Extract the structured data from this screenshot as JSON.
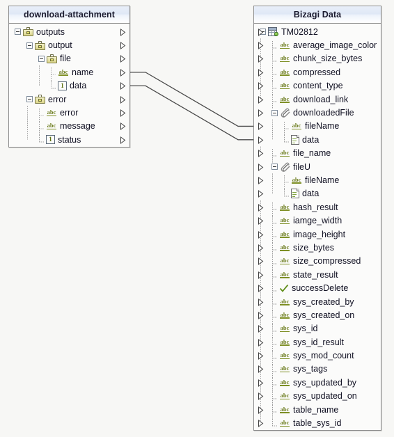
{
  "left_panel": {
    "title": "download-attachment",
    "nodes": [
      {
        "label": "outputs",
        "icon": "briefcase-icon",
        "depth": 0,
        "expander": true,
        "port": true
      },
      {
        "label": "output",
        "icon": "briefcase-icon",
        "depth": 1,
        "expander": true,
        "port": true
      },
      {
        "label": "file",
        "icon": "briefcase-icon",
        "depth": 2,
        "expander": true,
        "port": true
      },
      {
        "label": "name",
        "icon": "abc-string-icon",
        "depth": 3,
        "expander": false,
        "port": true
      },
      {
        "label": "data",
        "icon": "number-icon",
        "depth": 3,
        "expander": false,
        "port": true,
        "last": true
      },
      {
        "label": "error",
        "icon": "briefcase-icon",
        "depth": 1,
        "expander": true,
        "port": true
      },
      {
        "label": "error",
        "icon": "abc-string-icon",
        "depth": 2,
        "expander": false,
        "port": true
      },
      {
        "label": "message",
        "icon": "abc-string-icon",
        "depth": 2,
        "expander": false,
        "port": true
      },
      {
        "label": "status",
        "icon": "number-icon",
        "depth": 2,
        "expander": false,
        "port": true,
        "last": true
      }
    ]
  },
  "right_panel": {
    "title": "Bizagi Data",
    "nodes": [
      {
        "label": "TM02812",
        "icon": "table-icon",
        "depth": 0,
        "expander": true,
        "port": true
      },
      {
        "label": "average_image_color",
        "icon": "abc-string-icon",
        "depth": 1,
        "expander": false,
        "port": true
      },
      {
        "label": "chunk_size_bytes",
        "icon": "abc-string-icon",
        "depth": 1,
        "expander": false,
        "port": true
      },
      {
        "label": "compressed",
        "icon": "abc-string-icon",
        "depth": 1,
        "expander": false,
        "port": true
      },
      {
        "label": "content_type",
        "icon": "abc-string-icon",
        "depth": 1,
        "expander": false,
        "port": true
      },
      {
        "label": "download_link",
        "icon": "abc-string-icon",
        "depth": 1,
        "expander": false,
        "port": true
      },
      {
        "label": "downloadedFile",
        "icon": "paperclip-icon",
        "depth": 1,
        "expander": true,
        "port": true
      },
      {
        "label": "fileName",
        "icon": "abc-string-icon",
        "depth": 2,
        "expander": false,
        "port": true
      },
      {
        "label": "data",
        "icon": "document-icon",
        "depth": 2,
        "expander": false,
        "port": true,
        "last": true
      },
      {
        "label": "file_name",
        "icon": "abc-string-icon",
        "depth": 1,
        "expander": false,
        "port": true
      },
      {
        "label": "fileU",
        "icon": "paperclip-icon",
        "depth": 1,
        "expander": true,
        "port": true
      },
      {
        "label": "fileName",
        "icon": "abc-string-icon",
        "depth": 2,
        "expander": false,
        "port": true
      },
      {
        "label": "data",
        "icon": "document-icon",
        "depth": 2,
        "expander": false,
        "port": true,
        "last": true
      },
      {
        "label": "hash_result",
        "icon": "abc-string-icon",
        "depth": 1,
        "expander": false,
        "port": true
      },
      {
        "label": "iamge_width",
        "icon": "abc-string-icon",
        "depth": 1,
        "expander": false,
        "port": true
      },
      {
        "label": "image_height",
        "icon": "abc-string-icon",
        "depth": 1,
        "expander": false,
        "port": true
      },
      {
        "label": "size_bytes",
        "icon": "abc-string-icon",
        "depth": 1,
        "expander": false,
        "port": true
      },
      {
        "label": "size_compressed",
        "icon": "abc-string-icon",
        "depth": 1,
        "expander": false,
        "port": true
      },
      {
        "label": "state_result",
        "icon": "abc-string-icon",
        "depth": 1,
        "expander": false,
        "port": true
      },
      {
        "label": "successDelete",
        "icon": "check-boolean-icon",
        "depth": 1,
        "expander": false,
        "port": true
      },
      {
        "label": "sys_created_by",
        "icon": "abc-string-icon",
        "depth": 1,
        "expander": false,
        "port": true
      },
      {
        "label": "sys_created_on",
        "icon": "abc-string-icon",
        "depth": 1,
        "expander": false,
        "port": true
      },
      {
        "label": "sys_id",
        "icon": "abc-string-icon",
        "depth": 1,
        "expander": false,
        "port": true
      },
      {
        "label": "sys_id_result",
        "icon": "abc-string-icon",
        "depth": 1,
        "expander": false,
        "port": true
      },
      {
        "label": "sys_mod_count",
        "icon": "abc-string-icon",
        "depth": 1,
        "expander": false,
        "port": true
      },
      {
        "label": "sys_tags",
        "icon": "abc-string-icon",
        "depth": 1,
        "expander": false,
        "port": true
      },
      {
        "label": "sys_updated_by",
        "icon": "abc-string-icon",
        "depth": 1,
        "expander": false,
        "port": true
      },
      {
        "label": "sys_updated_on",
        "icon": "abc-string-icon",
        "depth": 1,
        "expander": false,
        "port": true
      },
      {
        "label": "table_name",
        "icon": "abc-string-icon",
        "depth": 1,
        "expander": false,
        "port": true
      },
      {
        "label": "table_sys_id",
        "icon": "abc-string-icon",
        "depth": 1,
        "expander": false,
        "port": true,
        "last": true
      }
    ]
  },
  "connections": [
    {
      "from": "name",
      "to": "fileName",
      "from_index": 3,
      "to_index": 7
    },
    {
      "from": "data",
      "to": "data",
      "from_index": 4,
      "to_index": 8
    }
  ],
  "colors": {
    "background": "#f7f7f5",
    "panel_background": "#fbfbfa",
    "panel_border": "#8d8d8d",
    "header_gradient_top": "#e9eff9",
    "header_gradient_bottom": "#ffffff",
    "text": "#101022",
    "string_icon": "#7e8f24",
    "connector_line": "#4a4a4a"
  }
}
